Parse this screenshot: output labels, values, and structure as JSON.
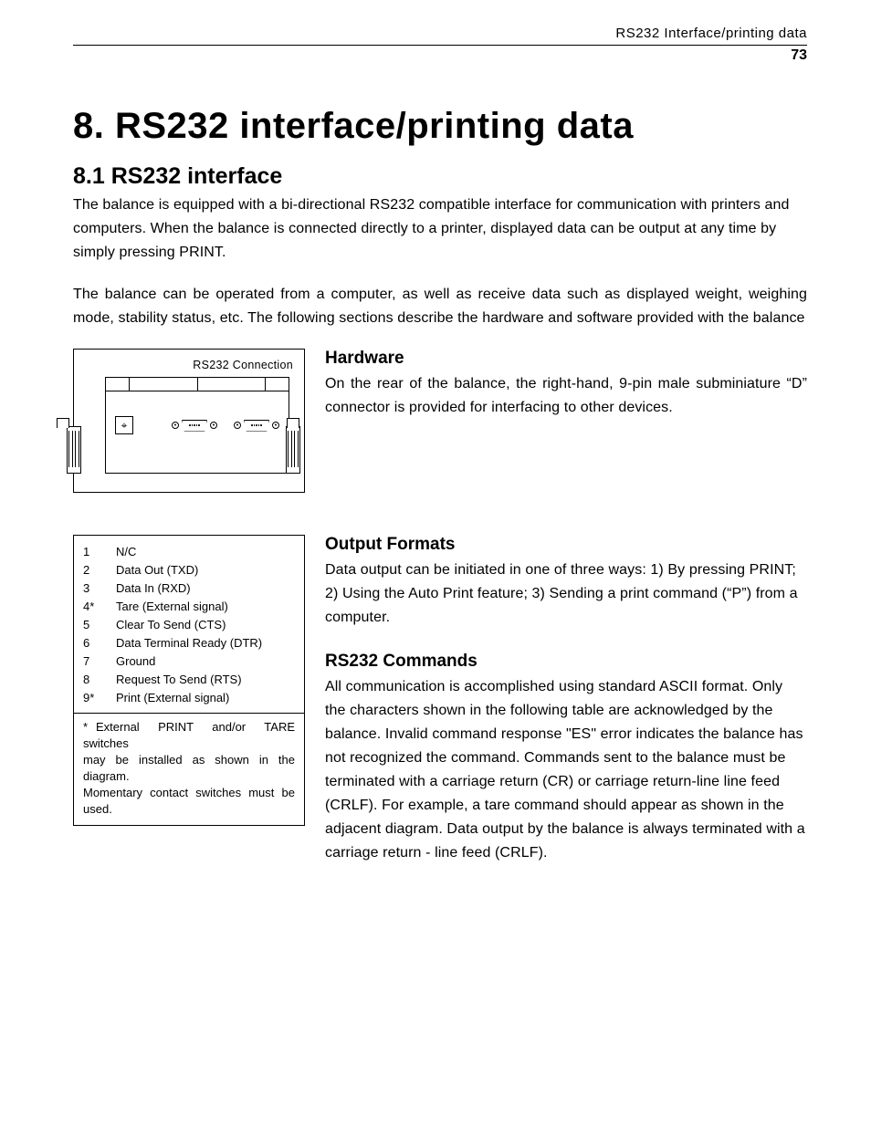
{
  "header": {
    "running_title": "RS232 Interface/printing data",
    "page_number": "73"
  },
  "h1": "8.  RS232 interface/printing data",
  "h2": "8.1  RS232 interface",
  "intro_p1": "The balance is equipped with a bi-directional RS232 compatible interface for communication with printers and computers. When the balance is connected directly to a printer, displayed data can be output at any time by simply pressing PRINT.",
  "intro_p2": "The balance can be operated from a computer, as well as receive data such as displayed weight, weighing mode, stability status, etc. The following sections describe the hardware and software provided with the balance",
  "diagram": {
    "label": "RS232 Connection"
  },
  "hardware": {
    "title": "Hardware",
    "body": "On the rear of the balance, the right-hand, 9-pin male subminiature “D” connector is provided for interfacing to other devices."
  },
  "pins": [
    {
      "n": "1",
      "label": "N/C"
    },
    {
      "n": "2",
      "label": "Data Out (TXD)"
    },
    {
      "n": "3",
      "label": "Data In (RXD)"
    },
    {
      "n": "4*",
      "label": "Tare (External signal)"
    },
    {
      "n": "5",
      "label": "Clear To Send (CTS)"
    },
    {
      "n": "6",
      "label": "Data Terminal Ready (DTR)"
    },
    {
      "n": "7",
      "label": "Ground"
    },
    {
      "n": "8",
      "label": "Request To Send (RTS)"
    },
    {
      "n": "9*",
      "label": "Print (External signal)"
    }
  ],
  "pin_note": {
    "star": "*",
    "line1": "External PRINT and/or TARE switches",
    "line2": "may be installed as shown in the diagram.",
    "line3": "Momentary contact switches must be used."
  },
  "output_formats": {
    "title": "Output Formats",
    "body": "Data output can be initiated in one of three ways: 1) By pressing PRINT; 2) Using the Auto Print feature; 3) Sending a print command (“P”) from a computer."
  },
  "rs232_commands": {
    "title": "RS232 Commands",
    "body": "All communication is accomplished using standard ASCII format. Only the characters shown in the following table are acknowledged by the balance. Invalid command response \"ES\" error indicates the balance has not recognized the command. Commands sent to the balance must be terminated with a carriage return (CR) or carriage return-line line feed (CRLF). For example, a tare command should appear as shown in the adjacent diagram. Data output by the balance is always terminated with a carriage return - line feed (CRLF)."
  }
}
